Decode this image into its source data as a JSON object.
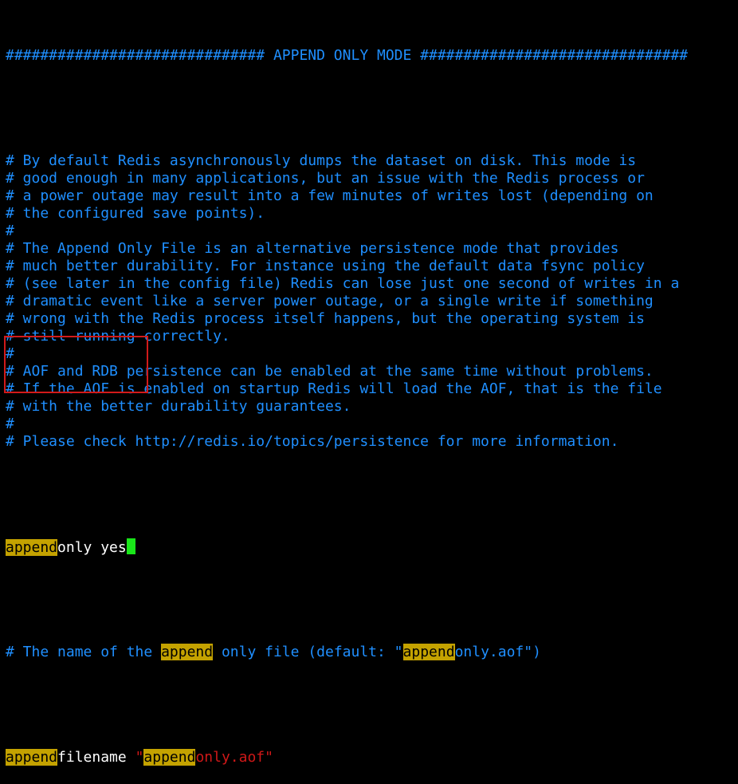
{
  "header_line": "############################## APPEND ONLY MODE ###############################",
  "comment_lines": [
    "# By default Redis asynchronously dumps the dataset on disk. This mode is",
    "# good enough in many applications, but an issue with the Redis process or",
    "# a power outage may result into a few minutes of writes lost (depending on",
    "# the configured save points).",
    "#",
    "# The Append Only File is an alternative persistence mode that provides",
    "# much better durability. For instance using the default data fsync policy",
    "# (see later in the config file) Redis can lose just one second of writes in a",
    "# dramatic event like a server power outage, or a single write if something",
    "# wrong with the Redis process itself happens, but the operating system is",
    "# still running correctly.",
    "#",
    "# AOF and RDB persistence can be enabled at the same time without problems.",
    "# If the AOF is enabled on startup Redis will load the AOF, that is the file",
    "# with the better durability guarantees.",
    "#",
    "# Please check http://redis.io/topics/persistence for more information."
  ],
  "config_line": {
    "search_match": "append",
    "rest": "only yes"
  },
  "name_comment": {
    "part1": "# The name of the ",
    "match1": "append",
    "part2": " only file (default: \"",
    "match2": "append",
    "part3": "only.aof\")"
  },
  "filename_line": {
    "match1": "append",
    "part1": "filename ",
    "quote_open": "\"",
    "match2": "append",
    "value_rest": "only.aof\""
  },
  "colors": {
    "comment": "#1f8fff",
    "text": "#ffffff",
    "search_highlight": "#c4a200",
    "cursor": "#19e619",
    "annotation_box": "#d21a1a",
    "string": "#d01818"
  }
}
